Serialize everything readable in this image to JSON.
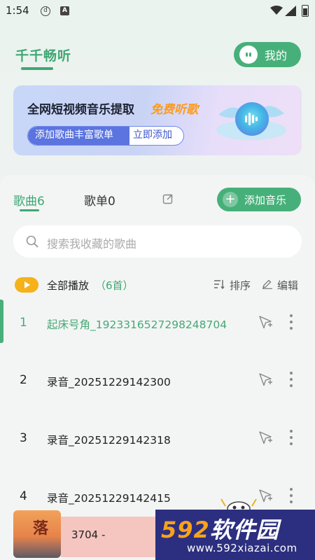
{
  "status_bar": {
    "time": "1:54",
    "icon1": "d",
    "icon2": "A"
  },
  "header": {
    "title": "千千畅听",
    "mine_label": "我的"
  },
  "banner": {
    "title": "全网短视频音乐提取",
    "highlight": "免费听歌",
    "pill_left": "添加歌曲丰富歌单",
    "pill_right": "立即添加"
  },
  "tabs": {
    "songs": "歌曲6",
    "playlists": "歌单0"
  },
  "add_music_label": "添加音乐",
  "search": {
    "placeholder": "搜索我收藏的歌曲"
  },
  "play_all": {
    "label": "全部播放",
    "count": "（6首）"
  },
  "toolbar": {
    "sort_label": "排序",
    "edit_label": "编辑"
  },
  "songs": [
    {
      "num": "1",
      "title": "起床号角_1923316527298248704"
    },
    {
      "num": "2",
      "title": "录音_20251229142300"
    },
    {
      "num": "3",
      "title": "录音_20251229142318"
    },
    {
      "num": "4",
      "title": "录音_20251229142415"
    }
  ],
  "player": {
    "art_text": "落",
    "track_text": "3704 -"
  },
  "watermark": {
    "main_digits": "592",
    "main_text": "软件园",
    "url": "www.592xiazai.com"
  },
  "colors": {
    "accent": "#47b07a",
    "highlight": "#ff9a1a",
    "play_all": "#f5b21a"
  }
}
